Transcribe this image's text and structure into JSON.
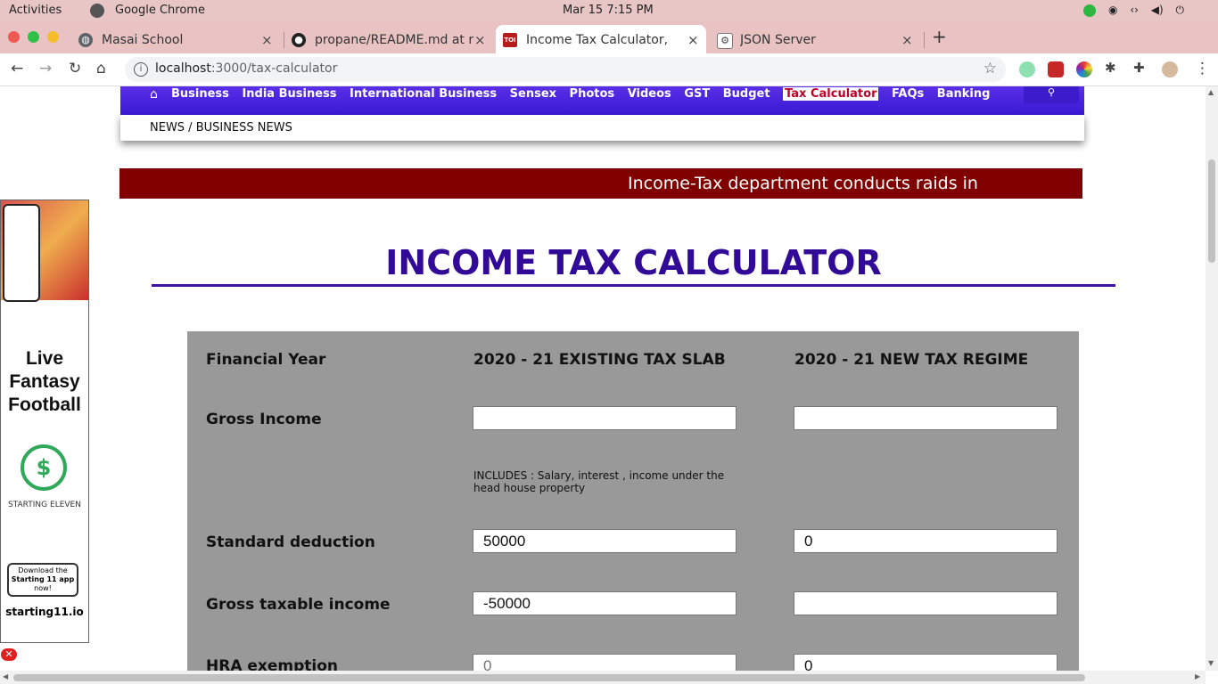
{
  "system": {
    "activities": "Activities",
    "app_name": "Google Chrome",
    "clock": "Mar 15   7:15 PM"
  },
  "tabs": [
    {
      "title": "Masai School",
      "close": "×"
    },
    {
      "title": "propane/README.md at r",
      "close": "×"
    },
    {
      "title": "Income Tax Calculator, Ca",
      "close": "×",
      "favicon": "TOI"
    },
    {
      "title": "JSON Server",
      "close": "×"
    }
  ],
  "toolbar": {
    "url_host": "localhost",
    "url_path": ":3000/tax-calculator",
    "new_tab": "+"
  },
  "nav": {
    "links": [
      "Business",
      "India Business",
      "International Business",
      "Sensex",
      "Photos",
      "Videos",
      "GST",
      "Budget",
      "Tax Calculator",
      "FAQs",
      "Banking"
    ],
    "active": "Tax Calculator",
    "breadcrumb": "NEWS / BUSINESS NEWS"
  },
  "ticker": "Income-Tax department conducts raids in Ko",
  "ad": {
    "headline": "Live Fantasy Football",
    "brand": "STARTING ELEVEN",
    "download_pre": "Download the",
    "download_app": "Starting 11 app",
    "download_post": "now!",
    "site": "starting11.io",
    "close": "✕"
  },
  "page_title": "INCOME TAX CALCULATOR",
  "calculator": {
    "col_label": "Financial Year",
    "col_existing": "2020 - 21 EXISTING TAX SLAB",
    "col_new": "2020 - 21 NEW TAX REGIME",
    "gross_income_label": "Gross Income",
    "gross_income_existing": "",
    "gross_income_new": "",
    "includes_note": "INCLUDES : Salary, interest , income under the head house property",
    "std_deduction_label": "Standard deduction",
    "std_deduction_existing": "50000",
    "std_deduction_new": "0",
    "gross_taxable_label": "Gross taxable income",
    "gross_taxable_existing": "-50000",
    "gross_taxable_new": "",
    "hra_label": "HRA exemption",
    "hra_existing_placeholder": "0",
    "hra_new": "0"
  },
  "colors": {
    "nav_bg": "#3a19d4",
    "ticker_bg": "#800000",
    "title": "#320a98",
    "calc_bg": "#999999",
    "active_link": "#c00026"
  }
}
